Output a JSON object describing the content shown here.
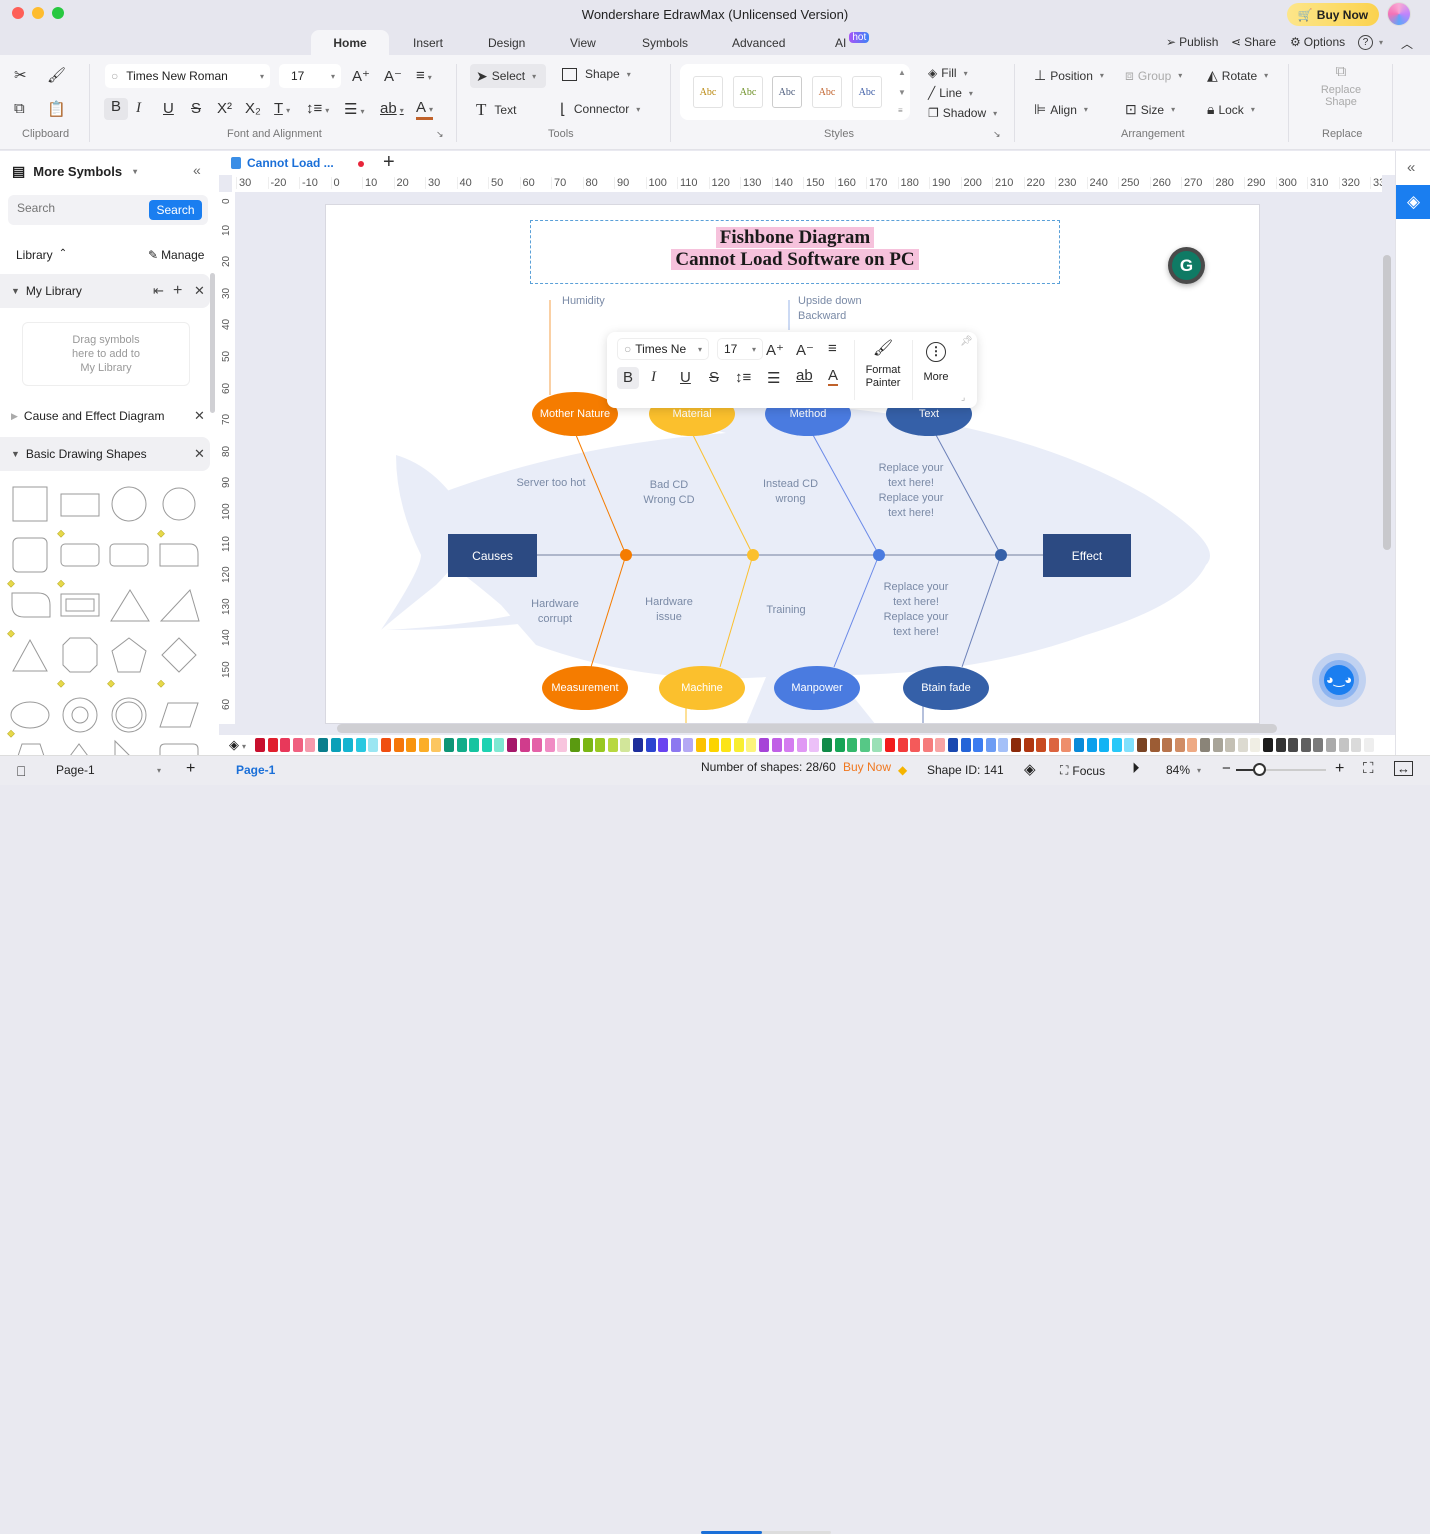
{
  "window": {
    "title": "Wondershare EdrawMax (Unlicensed Version)",
    "buy_now": "Buy Now"
  },
  "menu": {
    "tabs": [
      "Home",
      "Insert",
      "Design",
      "View",
      "Symbols",
      "Advanced",
      "AI"
    ],
    "active_tab": "Home",
    "ai_badge": "hot",
    "right": {
      "publish": "Publish",
      "share": "Share",
      "options": "Options"
    }
  },
  "ribbon": {
    "clipboard_label": "Clipboard",
    "font": {
      "family": "Times New Roman",
      "size": "17",
      "group_label": "Font and Alignment"
    },
    "tools": {
      "select": "Select",
      "shape": "Shape",
      "text": "Text",
      "connector": "Connector",
      "group_label": "Tools"
    },
    "styles": {
      "swatches": [
        {
          "label": "Abc",
          "color": "#b8860b"
        },
        {
          "label": "Abc",
          "color": "#6b8e23"
        },
        {
          "label": "Abc",
          "color": "#4a5a7a"
        },
        {
          "label": "Abc",
          "color": "#c0622b"
        },
        {
          "label": "Abc",
          "color": "#3b5ba5"
        }
      ],
      "fill": "Fill",
      "line": "Line",
      "shadow": "Shadow",
      "group_label": "Styles"
    },
    "arrangement": {
      "position": "Position",
      "group": "Group",
      "rotate": "Rotate",
      "align": "Align",
      "size": "Size",
      "lock": "Lock",
      "group_label": "Arrangement"
    },
    "replace": {
      "replace_shape_line1": "Replace",
      "replace_shape_line2": "Shape",
      "group_label": "Replace"
    }
  },
  "sidebar": {
    "title": "More Symbols",
    "search_placeholder": "Search",
    "search_button": "Search",
    "library_label": "Library",
    "manage_label": "Manage",
    "my_library": "My Library",
    "drop_hint_1": "Drag symbols",
    "drop_hint_2": "here to add to",
    "drop_hint_3": "My Library",
    "sections": [
      "Cause and Effect Diagram",
      "Basic Drawing Shapes"
    ]
  },
  "document": {
    "tab_name": "Cannot Load ...",
    "unsaved": true
  },
  "rulers": {
    "horizontal": [
      "30",
      "-20",
      "-10",
      "0",
      "10",
      "20",
      "30",
      "40",
      "50",
      "60",
      "70",
      "80",
      "90",
      "100",
      "110",
      "120",
      "130",
      "140",
      "150",
      "160",
      "170",
      "180",
      "190",
      "200",
      "210",
      "220",
      "230",
      "240",
      "250",
      "260",
      "270",
      "280",
      "290",
      "300",
      "310",
      "320",
      "33"
    ],
    "vertical": [
      "0",
      "10",
      "20",
      "30",
      "40",
      "50",
      "60",
      "70",
      "80",
      "90",
      "100",
      "110",
      "120",
      "130",
      "140",
      "150",
      "60"
    ]
  },
  "diagram": {
    "title_line1": "Fishbone Diagram",
    "title_line2": "Cannot Load Software on PC",
    "causes": "Causes",
    "effect": "Effect",
    "top_nodes": [
      {
        "label": "Mother Nature",
        "color": "#f57c00"
      },
      {
        "label": "Material",
        "color": "#fbc02d"
      },
      {
        "label": "Method",
        "color": "#4a7be0"
      },
      {
        "label": "Text",
        "color": "#3560a8"
      }
    ],
    "bottom_nodes": [
      {
        "label": "Measurement",
        "color": "#f57c00"
      },
      {
        "label": "Machine",
        "color": "#fbc02d"
      },
      {
        "label": "Manpower",
        "color": "#4a7be0"
      },
      {
        "label": "Btain fade",
        "color": "#3560a8"
      }
    ],
    "top_notes": [
      "Humidity",
      "Upside down",
      "Backward"
    ],
    "upper_texts": [
      "Server too hot",
      "Bad CD Wrong CD",
      "Instead CD wrong",
      "Replace your text here! Replace your text here!"
    ],
    "lower_texts": [
      "Hardware corrupt",
      "Hardware issue",
      "Training",
      "Replace your text here! Replace your text here!"
    ]
  },
  "floating_toolbar": {
    "font": "Times Ne",
    "size": "17",
    "format_painter_1": "Format",
    "format_painter_2": "Painter",
    "more": "More"
  },
  "palette": [
    "#c8102e",
    "#e0202e",
    "#e8385a",
    "#f06080",
    "#f59aac",
    "#0a7e8c",
    "#0aa0b8",
    "#14b4d0",
    "#28c8e0",
    "#9ae6f2",
    "#f04e10",
    "#f5760a",
    "#f8940e",
    "#fbae28",
    "#fcc660",
    "#0e9676",
    "#12ad8a",
    "#16c4a0",
    "#1ed2b2",
    "#7ee8d2",
    "#a6186a",
    "#d03c8c",
    "#e462a8",
    "#f08cc4",
    "#f8c4de",
    "#5a9a10",
    "#7ab614",
    "#98c820",
    "#b8d840",
    "#d2e69a",
    "#1e2e9c",
    "#2c44d0",
    "#6a44f0",
    "#8c78f0",
    "#b4a8f4",
    "#fcc200",
    "#fcd400",
    "#fce416",
    "#f8ee30",
    "#fcf47c",
    "#a644d8",
    "#c060e6",
    "#d47cf0",
    "#e098f4",
    "#ecc0f8",
    "#108a48",
    "#16a456",
    "#34b86c",
    "#56c886",
    "#9ae0b6",
    "#f21c1c",
    "#f23c3c",
    "#f45a5a",
    "#f67c7c",
    "#f8a4a4",
    "#1a48b0",
    "#2464d8",
    "#3c7cf0",
    "#6c9cf4",
    "#a4c0f8",
    "#8c2a0a",
    "#b03610",
    "#c84a20",
    "#dc6440",
    "#ee8e6c",
    "#0a8ad8",
    "#0aa0ec",
    "#12b4f4",
    "#28c8f8",
    "#80e0fc",
    "#7a4424",
    "#9c5c34",
    "#b8744c",
    "#d08c64",
    "#eeaa84",
    "#8a8478",
    "#a8a498",
    "#c4c0b4",
    "#dcdad0",
    "#f0eee4",
    "#1c1c1c",
    "#333333",
    "#4a4a4a",
    "#606060",
    "#7a7a7a",
    "#aaaaaa",
    "#c4c4c4",
    "#dadada",
    "#eeeeee"
  ],
  "status": {
    "page_selector": "Page-1",
    "page_tab": "Page-1",
    "shapes_count": "Number of shapes: 28/60",
    "shapes_fraction": 0.4667,
    "buy_now": "Buy Now",
    "shape_id": "Shape ID: 141",
    "focus": "Focus",
    "zoom": "84%",
    "zoom_slider_fraction": 0.25
  }
}
